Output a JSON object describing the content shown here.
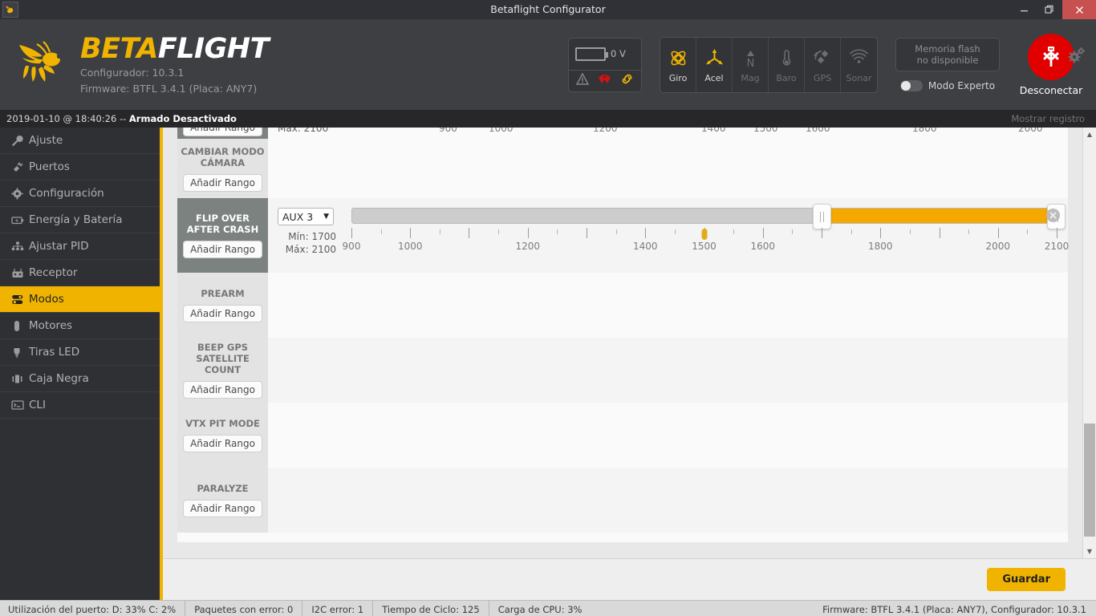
{
  "window": {
    "title": "Betaflight Configurator",
    "app_icon": "bee-icon",
    "minimize": "–",
    "restore": "❐",
    "close": "✕"
  },
  "header": {
    "brand_bold": "BETA",
    "brand_light": "FLIGHT",
    "configurator_line": "Configurador: 10.3.1",
    "firmware_line": "Firmware: BTFL 3.4.1 (Placa: ANY7)",
    "battery": {
      "voltage": "0 V",
      "icons": [
        "warning-icon",
        "parachute-icon",
        "link-icon"
      ]
    },
    "sensors": [
      {
        "name": "Giro",
        "icon": "gyro-icon",
        "active": true
      },
      {
        "name": "Acel",
        "icon": "accelerometer-icon",
        "active": true
      },
      {
        "name": "Mag",
        "icon": "compass-icon",
        "active": false
      },
      {
        "name": "Baro",
        "icon": "thermometer-icon",
        "active": false
      },
      {
        "name": "GPS",
        "icon": "satellite-icon",
        "active": false
      },
      {
        "name": "Sonar",
        "icon": "sonar-icon",
        "active": false
      }
    ],
    "flash_line1": "Memoria flash",
    "flash_line2": "no disponible",
    "expert_label": "Modo Experto",
    "disconnect_label": "Desconectar",
    "settings_icon": "gear-icon"
  },
  "logbar": {
    "timestamp": "2019-01-10 @ 18:40:26 -- ",
    "state": "Armado Desactivado",
    "show_log": "Mostrar registro"
  },
  "sidebar": {
    "accent": "#f0b400",
    "items": [
      {
        "label": "Ajuste",
        "icon": "wrench-icon",
        "active": false
      },
      {
        "label": "Puertos",
        "icon": "plug-icon",
        "active": false
      },
      {
        "label": "Configuración",
        "icon": "gear-icon",
        "active": false
      },
      {
        "label": "Energía y Batería",
        "icon": "battery-icon",
        "active": false
      },
      {
        "label": "Ajustar PID",
        "icon": "sliders-icon",
        "active": false
      },
      {
        "label": "Receptor",
        "icon": "transmitter-icon",
        "active": false
      },
      {
        "label": "Modos",
        "icon": "toggles-icon",
        "active": true
      },
      {
        "label": "Motores",
        "icon": "motor-icon",
        "active": false
      },
      {
        "label": "Tiras LED",
        "icon": "led-icon",
        "active": false
      },
      {
        "label": "Caja Negra",
        "icon": "blackbox-icon",
        "active": false
      },
      {
        "label": "CLI",
        "icon": "terminal-icon",
        "active": false
      }
    ]
  },
  "main": {
    "add_range_label": "Añadir Rango",
    "delete_icon": "close-circle-icon",
    "save_label": "Guardar",
    "slider": {
      "axis_min": 900,
      "axis_max": 2100,
      "major_ticks": [
        900,
        1000,
        1100,
        1200,
        1300,
        1400,
        1500,
        1600,
        1700,
        1800,
        1900,
        2000,
        2100
      ],
      "labeled_ticks": [
        900,
        1000,
        1200,
        1400,
        1500,
        1600,
        1800,
        2000,
        2100
      ],
      "minor_step": 50
    },
    "modes": [
      {
        "name": "",
        "clipped": true,
        "ranges": []
      },
      {
        "name": "CAMBIAR MODO CÁMARA",
        "active": false,
        "ranges": []
      },
      {
        "name": "FLIP OVER AFTER CRASH",
        "active": true,
        "ranges": [
          {
            "channel": "AUX 3",
            "min_label": "Mín: 1700",
            "max_label": "Máx: 2100",
            "min": 1700,
            "max": 2100,
            "channel_value": 1500
          }
        ]
      },
      {
        "name": "PREARM",
        "active": false,
        "ranges": []
      },
      {
        "name": "BEEP GPS SATELLITE COUNT",
        "active": false,
        "ranges": []
      },
      {
        "name": "VTX PIT MODE",
        "active": false,
        "ranges": []
      },
      {
        "name": "PARALYZE",
        "active": false,
        "ranges": []
      }
    ]
  },
  "statusbar": {
    "items": [
      "Utilización del puerto: D: 33% C: 2%",
      "Paquetes con error: 0",
      "I2C error: 1",
      "Tiempo de Ciclo: 125",
      "Carga de CPU: 3%"
    ],
    "right": "Firmware: BTFL 3.4.1 (Placa: ANY7), Configurador: 10.3.1"
  }
}
